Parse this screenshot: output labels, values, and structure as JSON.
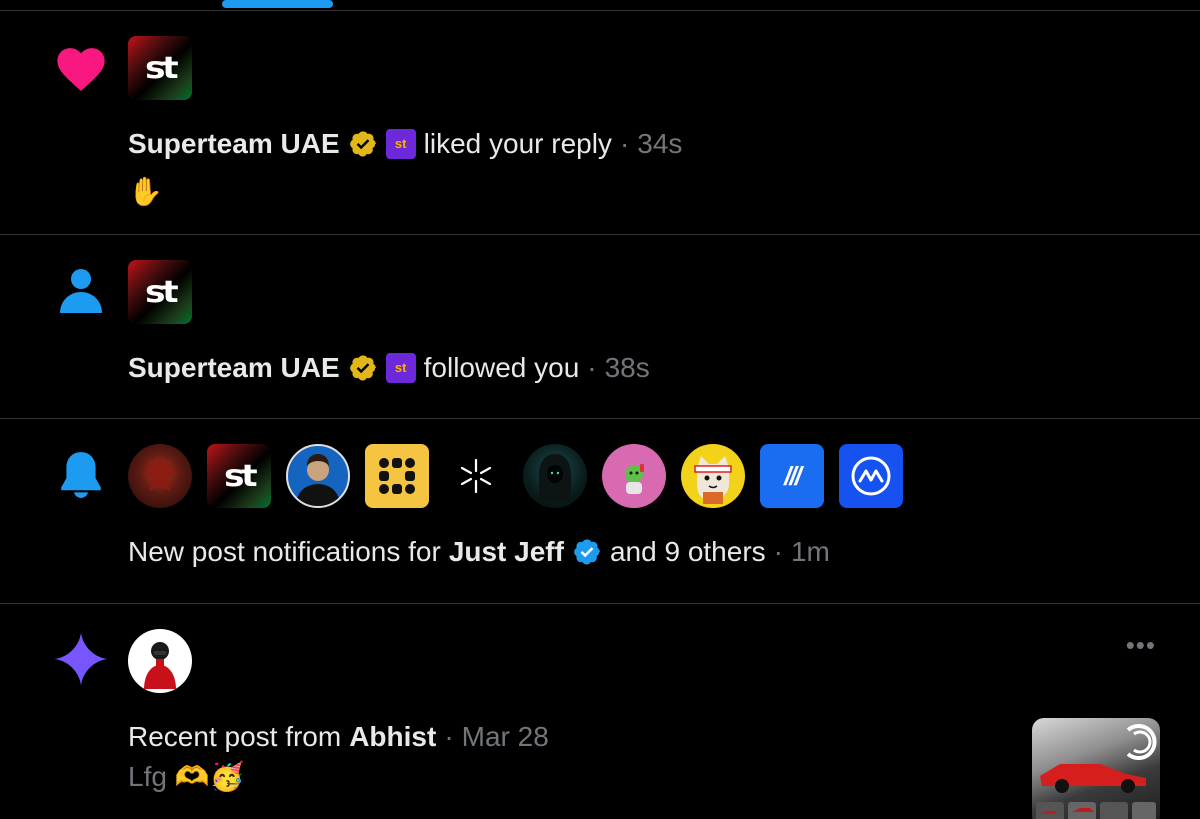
{
  "tabs": {
    "active_indicator_color": "#1d9bf0"
  },
  "notifications": [
    {
      "type": "like",
      "icon": "heart-icon",
      "icon_color": "#f91880",
      "actor": "Superteam UAE",
      "verified": "gold",
      "affiliate_badge": "st",
      "action": "liked your reply",
      "separator": "·",
      "time": "34s",
      "content": "✋",
      "avatar_text": "st"
    },
    {
      "type": "follow",
      "icon": "person-icon",
      "icon_color": "#1d9bf0",
      "actor": "Superteam UAE",
      "verified": "gold",
      "affiliate_badge": "st",
      "action": "followed you",
      "separator": "·",
      "time": "38s",
      "avatar_text": "st"
    },
    {
      "type": "new-post-notifications",
      "icon": "bell-icon",
      "icon_color": "#1d9bf0",
      "prefix": "New post notifications for",
      "actor": "Just Jeff",
      "verified": "blue",
      "suffix": "and 9 others",
      "separator": "·",
      "time": "1m",
      "avatars": [
        "red-creature-avatar",
        "superteam-avatar",
        "man-portrait-avatar",
        "yellow-grid-logo-avatar",
        "asterisk-logo-avatar",
        "hooded-figure-avatar",
        "green-character-avatar",
        "cat-cartoon-avatar",
        "blue-slash-logo-avatar",
        "coinmarketcap-logo-avatar"
      ],
      "avatar_texts": {
        "st": "st",
        "slash": "///"
      }
    },
    {
      "type": "recent-post",
      "icon": "sparkle-icon",
      "icon_color": "#7856ff",
      "prefix": "Recent post from",
      "actor": "Abhist",
      "separator": "·",
      "time": "Mar 28",
      "content": "Lfg 🫶🥳",
      "more": "•••"
    }
  ]
}
